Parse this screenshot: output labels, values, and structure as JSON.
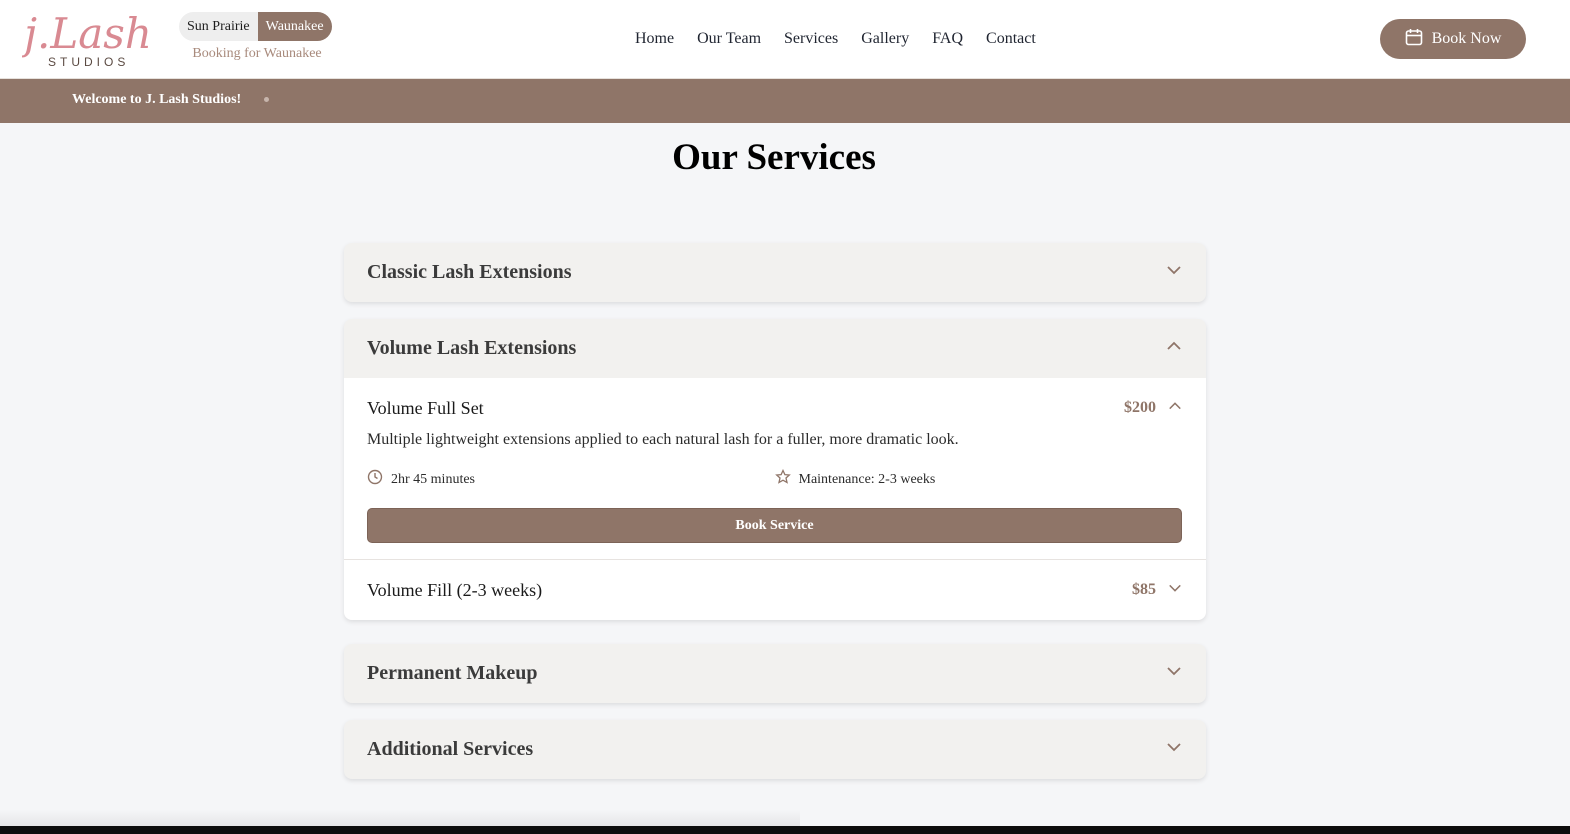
{
  "brand": {
    "logo_script": "j.Lash",
    "logo_sub": "STUDIOS",
    "accent": "#8f7568",
    "logo_pink": "#d98a92"
  },
  "location_toggle": {
    "options": [
      "Sun Prairie",
      "Waunakee"
    ],
    "selected": "Waunakee",
    "note": "Booking for Waunakee"
  },
  "nav": {
    "items": [
      "Home",
      "Our Team",
      "Services",
      "Gallery",
      "FAQ",
      "Contact"
    ]
  },
  "header": {
    "book_now_label": "Book Now",
    "book_now_icon": "calendar-icon"
  },
  "banner": {
    "text": "Welcome to J. Lash Studios!"
  },
  "page": {
    "title": "Our Services"
  },
  "categories": [
    {
      "title": "Classic Lash Extensions",
      "expanded": false
    },
    {
      "title": "Volume Lash Extensions",
      "expanded": true,
      "services": [
        {
          "name": "Volume Full Set",
          "price": "$200",
          "expanded": true,
          "description": "Multiple lightweight extensions applied to each natural lash for a fuller, more dramatic look.",
          "duration": "2hr 45 minutes",
          "maintenance": "Maintenance: 2-3 weeks",
          "book_label": "Book Service"
        },
        {
          "name": "Volume Fill (2-3 weeks)",
          "price": "$85",
          "expanded": false
        }
      ]
    },
    {
      "title": "Permanent Makeup",
      "expanded": false
    },
    {
      "title": "Additional Services",
      "expanded": false
    }
  ]
}
